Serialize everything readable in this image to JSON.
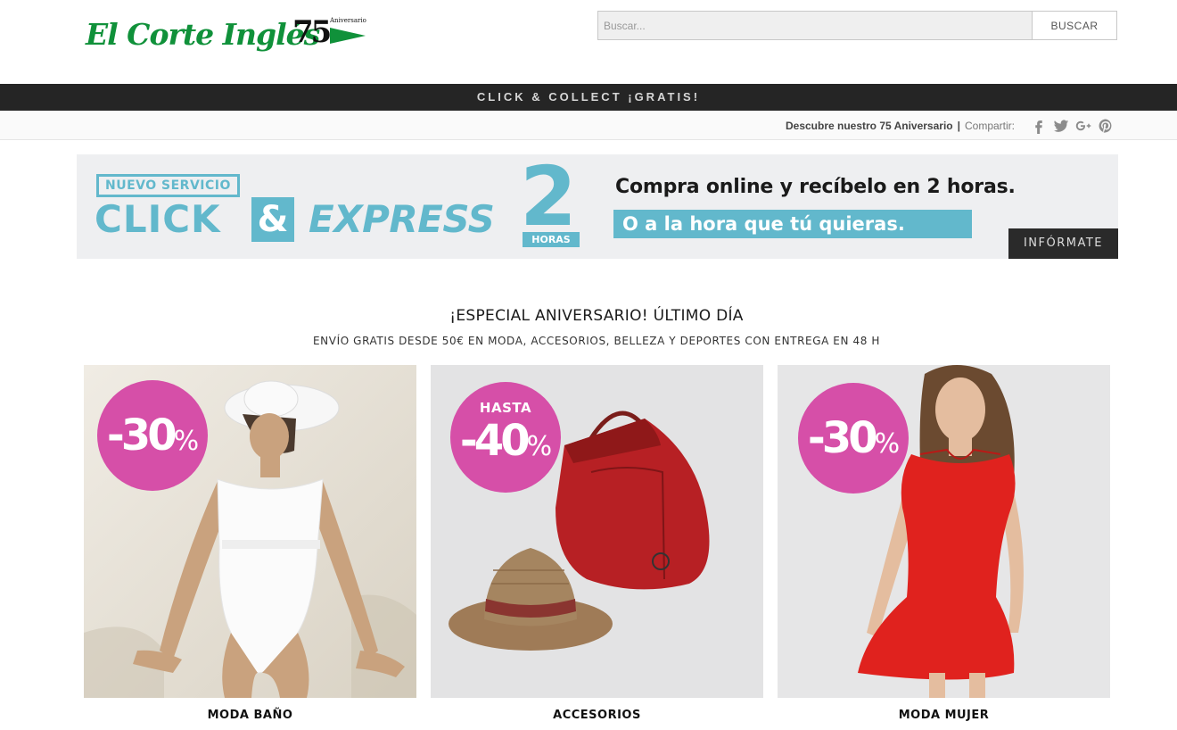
{
  "header": {
    "logo_text": "El Corte Inglés",
    "anniversary_number": "75",
    "anniversary_label": "Aniversario",
    "search": {
      "placeholder": "Buscar...",
      "button_label": "BUSCAR"
    }
  },
  "promo_bar": {
    "text": "CLICK & COLLECT ¡GRATIS!"
  },
  "subbar": {
    "anniversary_link": "Descubre nuestro 75 Aniversario",
    "separator": "|",
    "share_label": "Compartir:",
    "social_icons": [
      "facebook-icon",
      "twitter-icon",
      "google-plus-icon",
      "pinterest-icon"
    ]
  },
  "express_banner": {
    "badge": "NUEVO SERVICIO",
    "click": "CLICK",
    "amp": "&",
    "express": "EXPRESS",
    "number": "2",
    "horas": "HORAS",
    "tagline_1": "Compra online y recíbelo en 2 horas.",
    "tagline_2": "O a la hora que tú quieras.",
    "cta": "INFÓRMATE",
    "accent_color": "#62b8cc"
  },
  "section": {
    "title": "¡ESPECIAL ANIVERSARIO! ÚLTIMO DÍA",
    "subtitle": "ENVÍO GRATIS DESDE 50€ EN MODA, ACCESORIOS, BELLEZA Y DEPORTES CON ENTREGA EN 48 H"
  },
  "products": [
    {
      "label": "MODA BAÑO",
      "discount": "-30",
      "percent": "%",
      "prefix": ""
    },
    {
      "label": "ACCESORIOS",
      "discount": "-40",
      "percent": "%",
      "prefix": "HASTA"
    },
    {
      "label": "MODA MUJER",
      "discount": "-30",
      "percent": "%",
      "prefix": ""
    }
  ],
  "colors": {
    "brand_green": "#10913a",
    "badge_pink": "#d64fa8",
    "dark_bar": "#252525"
  }
}
